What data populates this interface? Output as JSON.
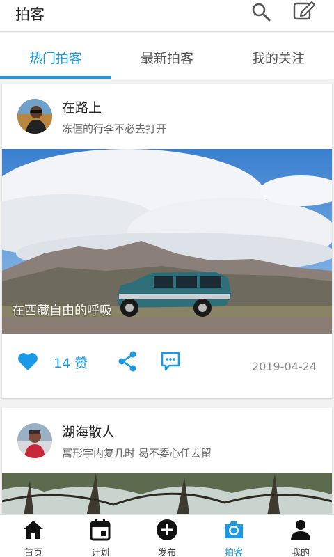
{
  "header": {
    "title": "拍客"
  },
  "tabs": [
    {
      "label": "热门拍客",
      "active": true
    },
    {
      "label": "最新拍客",
      "active": false
    },
    {
      "label": "我的关注",
      "active": false
    }
  ],
  "posts": [
    {
      "user_name": "在路上",
      "signature": "冻僵的行李不必去打开",
      "photo_caption": "在西藏自由的呼吸",
      "likes": "14 赞",
      "date": "2019-04-24"
    },
    {
      "user_name": "湖海散人",
      "signature": "寓形宇内复几时 曷不委心任去留"
    }
  ],
  "bottom_nav": [
    {
      "label": "首页",
      "icon": "home-icon"
    },
    {
      "label": "计划",
      "icon": "calendar-icon"
    },
    {
      "label": "发布",
      "icon": "add-circle-icon"
    },
    {
      "label": "拍客",
      "icon": "camera-icon",
      "active": true
    },
    {
      "label": "我的",
      "icon": "person-icon"
    }
  ],
  "colors": {
    "accent": "#1a9ae6"
  }
}
